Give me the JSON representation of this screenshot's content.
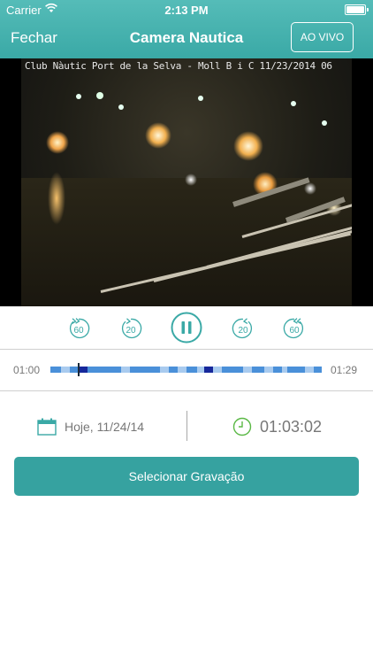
{
  "status_bar": {
    "carrier": "Carrier",
    "time": "2:13 PM",
    "icons": [
      "wifi-icon",
      "battery-icon"
    ]
  },
  "nav": {
    "close_label": "Fechar",
    "title": "Camera Nautica",
    "live_label": "AO VIVO"
  },
  "video": {
    "overlay_caption": "Club Nàutic Port de la Selva - Moll B i C 11/23/2014 06"
  },
  "controls": {
    "rewind_60": "60",
    "rewind_20": "20",
    "forward_20": "20",
    "forward_60": "60",
    "play_state": "pause-icon"
  },
  "timeline": {
    "start": "01:00",
    "end": "01:29"
  },
  "date_label": "Hoje, 11/24/14",
  "time_value": "01:03:02",
  "select_label": "Selecionar Gravação",
  "colors": {
    "accent": "#3aa9a6",
    "segment_dark": "#16279a",
    "segment_mid": "#4a90d9",
    "segment_light": "#a9cbef"
  }
}
